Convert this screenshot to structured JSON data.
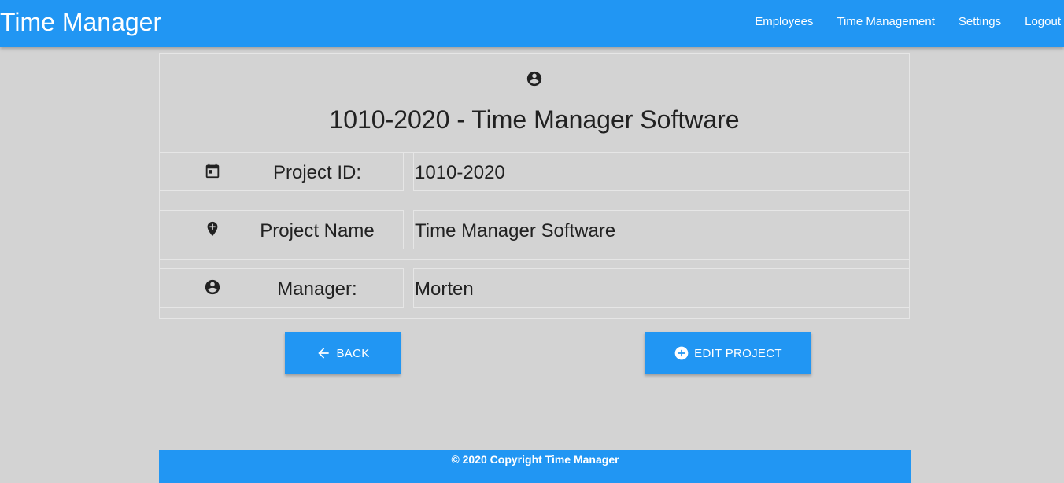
{
  "app": {
    "title": "Time Manager"
  },
  "nav": {
    "items": [
      {
        "label": "Employees"
      },
      {
        "label": "Time Management"
      },
      {
        "label": "Settings"
      },
      {
        "label": "Logout"
      }
    ]
  },
  "project": {
    "title": "1010-2020 - Time Manager Software",
    "header_icon": "account-circle-icon",
    "rows": [
      {
        "icon": "calendar-icon",
        "label": "Project ID:",
        "value": "1010-2020"
      },
      {
        "icon": "add-location-icon",
        "label": "Project Name",
        "value": "Time Manager Software"
      },
      {
        "icon": "account-circle-icon",
        "label": "Manager:",
        "value": "Morten"
      }
    ]
  },
  "actions": {
    "back_label": "BACK",
    "back_icon": "arrow-left-icon",
    "edit_label": "EDIT PROJECT",
    "edit_icon": "plus-circle-icon"
  },
  "footer": {
    "text": "© 2020 Copyright Time Manager"
  },
  "colors": {
    "primary": "#2196f3",
    "background": "#d3d3d3",
    "text": "#212121"
  }
}
